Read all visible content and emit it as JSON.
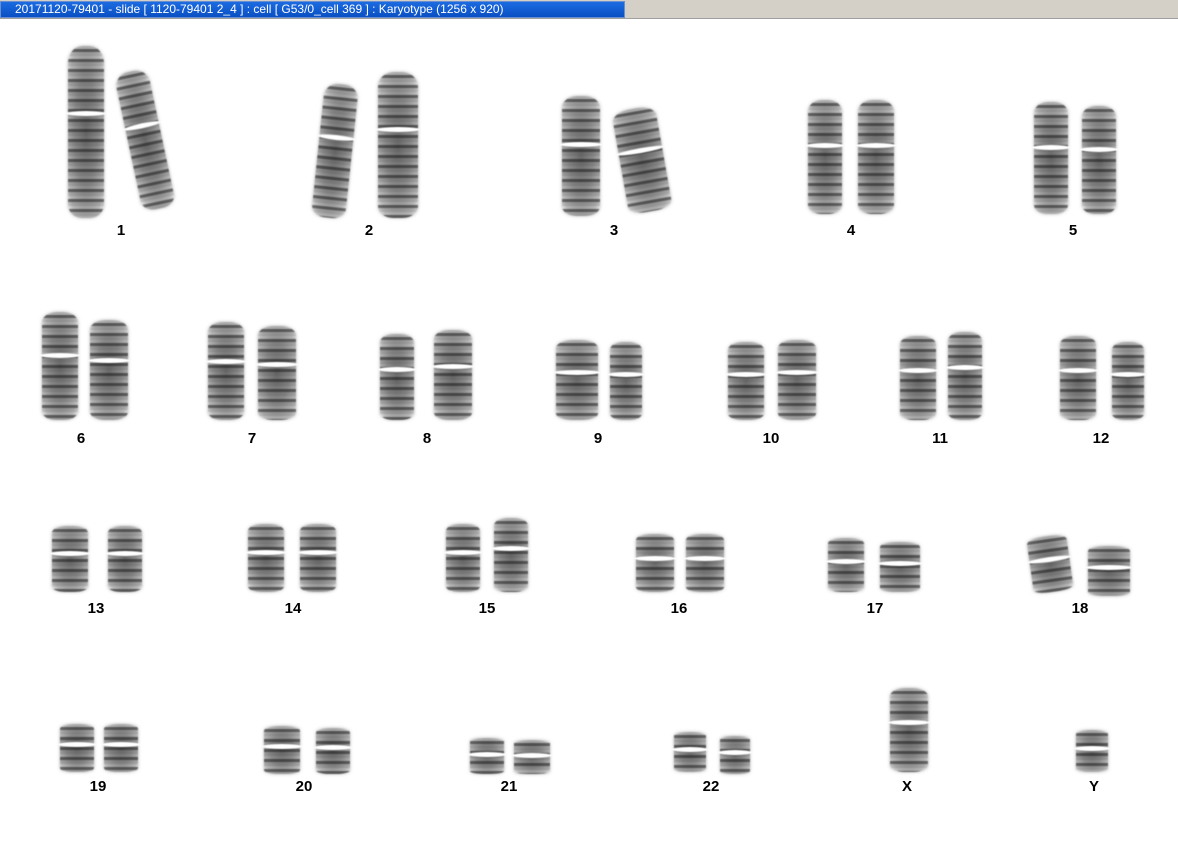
{
  "window": {
    "title": "20171120-79401 - slide [ 1120-79401 2_4 ] : cell [ G53/0_cell 369 ] : Karyotype  (1256 x 920)"
  },
  "karyotype": {
    "rows": [
      [
        "1",
        "2",
        "3",
        "4",
        "5"
      ],
      [
        "6",
        "7",
        "8",
        "9",
        "10",
        "11",
        "12"
      ],
      [
        "13",
        "14",
        "15",
        "16",
        "17",
        "18"
      ],
      [
        "19",
        "20",
        "21",
        "22",
        "X",
        "Y"
      ]
    ],
    "colors": {
      "chromosome": "#6a6a6a",
      "background": "#ffffff",
      "title_bar": "#0a4fc4"
    }
  }
}
